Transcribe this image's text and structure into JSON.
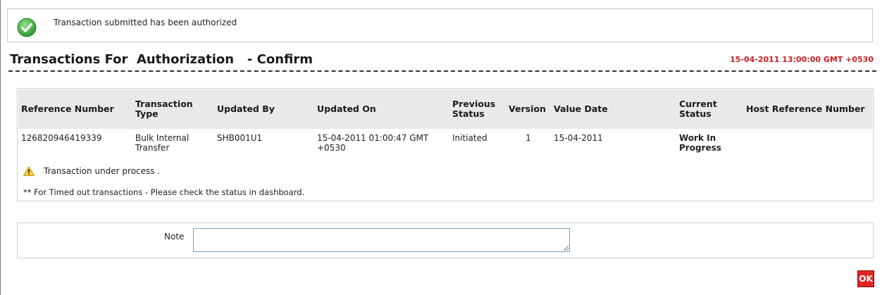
{
  "message": {
    "icon": "success-check-icon",
    "text": "Transaction submitted has been authorized"
  },
  "page": {
    "title": "Transactions For  Authorization   - Confirm",
    "timestamp": "15-04-2011 13:00:00 GMT +0530"
  },
  "table": {
    "headers": {
      "reference_number": "Reference Number",
      "transaction_type": "Transaction Type",
      "updated_by": "Updated By",
      "updated_on": "Updated On",
      "previous_status": "Previous Status",
      "version": "Version",
      "value_date": "Value Date",
      "current_status": "Current Status",
      "host_reference_number": "Host Reference Number"
    },
    "rows": [
      {
        "reference_number": "126820946419339",
        "transaction_type": "Bulk Internal Transfer",
        "updated_by": "SHB001U1",
        "updated_on": "15-04-2011 01:00:47 GMT +0530",
        "previous_status": "Initiated",
        "version": "1",
        "value_date": "15-04-2011",
        "current_status": "Work In Progress",
        "host_reference_number": ""
      }
    ],
    "process_icon": "warning-icon",
    "process_message": "Transaction under process .",
    "timed_out_note": "** For Timed out transactions - Please check the status in dashboard."
  },
  "note": {
    "label": "Note",
    "value": ""
  },
  "actions": {
    "ok_label": "OK"
  },
  "colors": {
    "timestamp": "#cc1f1f",
    "ok_button": "#e12525",
    "header_row": "#e9e9e9",
    "success_icon": "#3aa53a"
  }
}
